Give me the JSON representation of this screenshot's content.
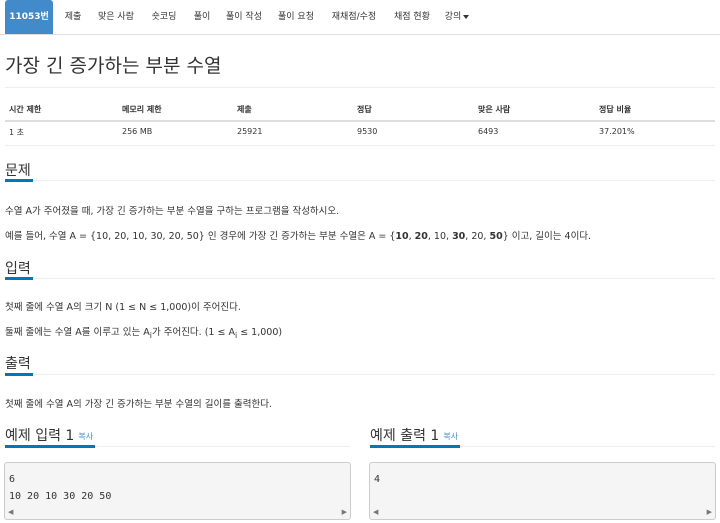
{
  "tabs": [
    {
      "label": "11053번",
      "active": true
    },
    {
      "label": "제출"
    },
    {
      "label": "맞은 사람"
    },
    {
      "label": "숏코딩"
    },
    {
      "label": "풀이"
    },
    {
      "label": "풀이 작성"
    },
    {
      "label": "풀이 요청"
    },
    {
      "label": "재채점/수정"
    },
    {
      "label": "채점 현황"
    },
    {
      "label": "강의"
    }
  ],
  "problem_title": "가장 긴 증가하는 부분 수열",
  "info": {
    "headers": [
      "시간 제한",
      "메모리 제한",
      "제출",
      "정답",
      "맞은 사람",
      "정답 비율"
    ],
    "values": [
      "1 초",
      "256 MB",
      "25921",
      "9530",
      "6493",
      "37.201%"
    ]
  },
  "sections": {
    "description": {
      "title": "문제",
      "p1": "수열 A가 주어졌을 때, 가장 긴 증가하는 부분 수열을 구하는 프로그램을 작성하시오.",
      "p2_pre": "예를 들어, 수열 A = {10, 20, 10, 30, 20, 50} 인 경우에 가장 긴 증가하는 부분 수열은 A = {",
      "p2_b1": "10",
      "p2_c1": ", ",
      "p2_b2": "20",
      "p2_c2": ", 10, ",
      "p2_b3": "30",
      "p2_c3": ", 20, ",
      "p2_b4": "50",
      "p2_post": "} 이고, 길이는 4이다."
    },
    "input": {
      "title": "입력",
      "p1": "첫째 줄에 수열 A의 크기 N (1 ≤ N ≤ 1,000)이 주어진다.",
      "p2_pre": "둘째 줄에는 수열 A를 이루고 있는 A",
      "p2_sub": "i",
      "p2_mid": "가 주어진다. (1 ≤ A",
      "p2_sub2": "i",
      "p2_post": " ≤ 1,000)"
    },
    "output": {
      "title": "출력",
      "p1": "첫째 줄에 수열 A의 가장 긴 증가하는 부분 수열의 길이를 출력한다."
    }
  },
  "sample_input": {
    "title": "예제 입력 1",
    "copy": "복사",
    "content": "6\n10 20 10 30 20 50"
  },
  "sample_output": {
    "title": "예제 출력 1",
    "copy": "복사",
    "content": "4"
  },
  "scroll": {
    "left": "◀",
    "right": "▶"
  }
}
